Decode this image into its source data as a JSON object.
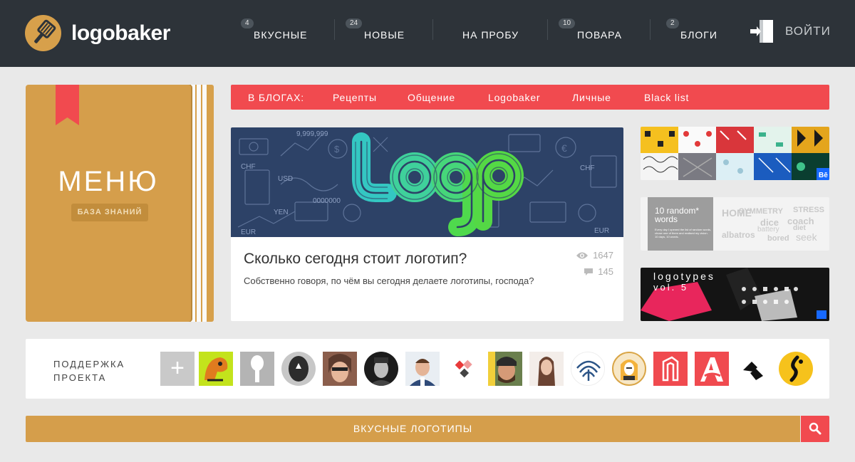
{
  "header": {
    "logo_text": "logobaker",
    "nav": [
      {
        "badge": "4",
        "label": "ВКУСНЫЕ"
      },
      {
        "badge": "24",
        "label": "НОВЫЕ"
      },
      {
        "badge": "",
        "label": "НА ПРОБУ"
      },
      {
        "badge": "10",
        "label": "ПОВАРА"
      },
      {
        "badge": "2",
        "label": "БЛОГИ"
      }
    ],
    "login_label": "ВОЙТИ"
  },
  "menu": {
    "title": "МЕНЮ",
    "subtitle": "БАЗА ЗНАНИЙ"
  },
  "blogs": {
    "heading": "В БЛОГАХ:",
    "items": [
      "Рецепты",
      "Общение",
      "Logobaker",
      "Личные",
      "Black list"
    ]
  },
  "article": {
    "image_word": "logo",
    "title": "Сколько сегодня стоит логотип?",
    "excerpt": "Собственно говоря, по чём вы сегодня делаете логотипы, господа?",
    "views": "1647",
    "comments": "145"
  },
  "thumbs": {
    "random_title": "10 random* words",
    "random_text": "Every day I opened the list of random words, chose one of them and realised my vision. 10 days, 10 words.",
    "random_words": [
      "HOME",
      "SYMMETRY",
      "STRESS",
      "dice",
      "coach",
      "albatros",
      "battery",
      "bored",
      "seek",
      "diet"
    ],
    "logotypes_title": "logotypes",
    "logotypes_vol": "vol. 5",
    "behance": "Bē"
  },
  "support": {
    "label": "ПОДДЕРЖКА ПРОЕКТА",
    "add_symbol": "+"
  },
  "tasty_bar": {
    "label": "ВКУСНЫЕ ЛОГОТИПЫ"
  },
  "colors": {
    "header_bg": "#2d3339",
    "accent_orange": "#d59e4b",
    "accent_red": "#f14a4f",
    "page_bg": "#e9e9e9"
  }
}
